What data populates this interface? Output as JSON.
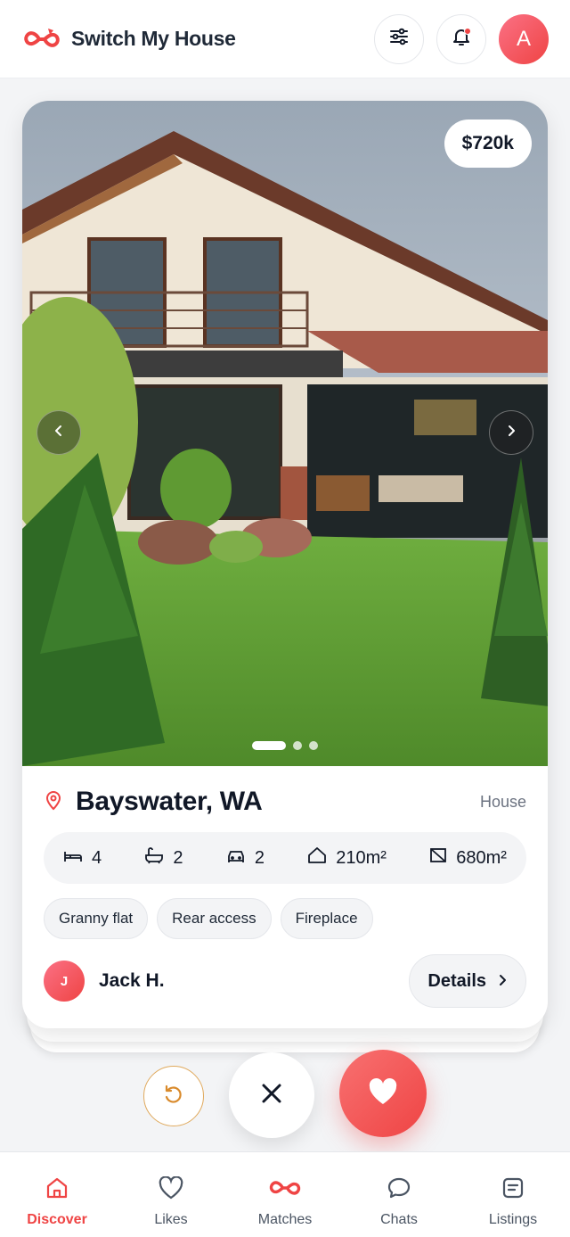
{
  "app": {
    "name": "Switch My House",
    "user_initial": "A",
    "accent": "#ef4444"
  },
  "header": {
    "filter_icon": "sliders-icon",
    "notification_icon": "bell-icon",
    "has_unread_notification": true
  },
  "listing": {
    "price": "$720k",
    "location": "Bayswater, WA",
    "property_type": "House",
    "photo_count": 3,
    "active_photo_index": 0,
    "specs": [
      {
        "icon": "bed-icon",
        "value": "4"
      },
      {
        "icon": "bath-icon",
        "value": "2"
      },
      {
        "icon": "car-icon",
        "value": "2"
      },
      {
        "icon": "house-area-icon",
        "value": "210m²"
      },
      {
        "icon": "land-area-icon",
        "value": "680m²"
      }
    ],
    "tags": [
      "Granny flat",
      "Rear access",
      "Fireplace"
    ],
    "owner": {
      "initial": "J",
      "name": "Jack H."
    },
    "details_label": "Details"
  },
  "actions": {
    "undo_icon": "undo-icon",
    "pass_icon": "close-icon",
    "like_icon": "heart-icon"
  },
  "bottom_nav": [
    {
      "label": "Discover",
      "icon": "home-icon",
      "active": true
    },
    {
      "label": "Likes",
      "icon": "heart-outline-icon",
      "active": false
    },
    {
      "label": "Matches",
      "icon": "swap-logo-icon",
      "active": false
    },
    {
      "label": "Chats",
      "icon": "chat-bubble-icon",
      "active": false
    },
    {
      "label": "Listings",
      "icon": "list-icon",
      "active": false
    }
  ]
}
